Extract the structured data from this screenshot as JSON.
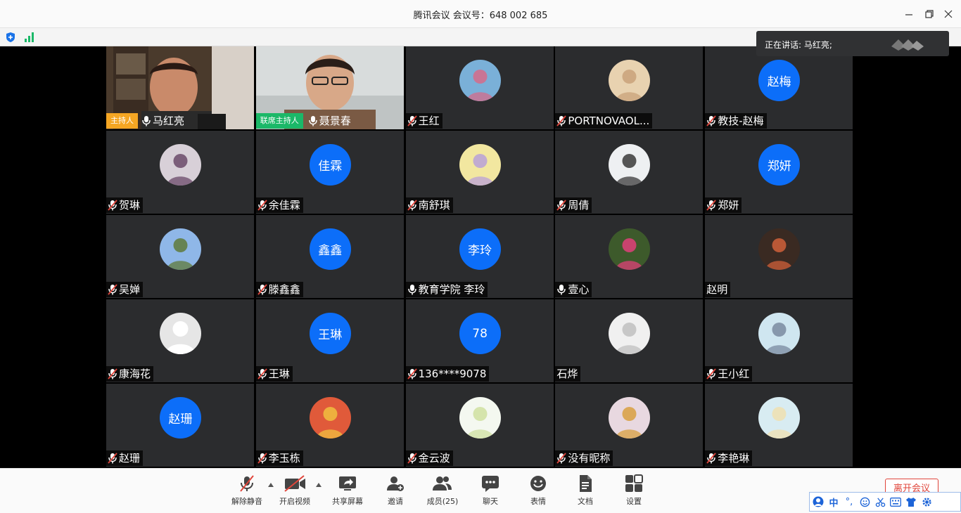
{
  "window": {
    "title": "腾讯会议 会议号：648 002 685"
  },
  "speaking": {
    "text": "正在讲话: 马红亮;"
  },
  "roles": {
    "host": "主持人",
    "cohost": "联席主持人"
  },
  "participants": [
    {
      "name": "马红亮",
      "mic": "on",
      "avatar": "video-host",
      "role": "host"
    },
    {
      "name": "聂景春",
      "mic": "on",
      "avatar": "video-cohost",
      "role": "cohost"
    },
    {
      "name": "王红",
      "mic": "muted",
      "avatar": "photo"
    },
    {
      "name": "PORTNOVAOL...",
      "mic": "muted",
      "avatar": "photo"
    },
    {
      "name": "教技-赵梅",
      "mic": "muted",
      "avatar": "text",
      "avatar_text": "赵梅"
    },
    {
      "name": "贺琳",
      "mic": "muted",
      "avatar": "photo"
    },
    {
      "name": "余佳霖",
      "mic": "muted",
      "avatar": "text",
      "avatar_text": "佳霖"
    },
    {
      "name": "南舒琪",
      "mic": "muted",
      "avatar": "photo"
    },
    {
      "name": "周倩",
      "mic": "muted",
      "avatar": "photo"
    },
    {
      "name": "郑妍",
      "mic": "muted",
      "avatar": "text",
      "avatar_text": "郑妍"
    },
    {
      "name": "吴婵",
      "mic": "muted",
      "avatar": "photo"
    },
    {
      "name": "滕鑫鑫",
      "mic": "muted",
      "avatar": "text",
      "avatar_text": "鑫鑫"
    },
    {
      "name": "教育学院 李玲",
      "mic": "on",
      "avatar": "text",
      "avatar_text": "李玲"
    },
    {
      "name": "壹心",
      "mic": "on",
      "avatar": "photo"
    },
    {
      "name": "赵明",
      "mic": "none",
      "avatar": "photo"
    },
    {
      "name": "康海花",
      "mic": "muted",
      "avatar": "default"
    },
    {
      "name": "王琳",
      "mic": "muted",
      "avatar": "text",
      "avatar_text": "王琳"
    },
    {
      "name": "136****9078",
      "mic": "muted",
      "avatar": "text",
      "avatar_text": "78"
    },
    {
      "name": "石烨",
      "mic": "none",
      "avatar": "photo"
    },
    {
      "name": "王小红",
      "mic": "muted",
      "avatar": "photo"
    },
    {
      "name": "赵珊",
      "mic": "muted",
      "avatar": "text",
      "avatar_text": "赵珊"
    },
    {
      "name": "李玉栋",
      "mic": "muted",
      "avatar": "photo"
    },
    {
      "name": "金云波",
      "mic": "muted",
      "avatar": "photo"
    },
    {
      "name": "没有昵称",
      "mic": "muted",
      "avatar": "photo"
    },
    {
      "name": "李艳琳",
      "mic": "muted",
      "avatar": "photo"
    }
  ],
  "toolbar": {
    "unmute": "解除静音",
    "start_video": "开启视频",
    "share_screen": "共享屏幕",
    "invite": "邀请",
    "members": "成员(25)",
    "chat": "聊天",
    "reactions": "表情",
    "docs": "文档",
    "settings": "设置",
    "leave": "离开会议"
  },
  "ime": {
    "mode": "中",
    "punct": "°,"
  },
  "colors": {
    "accent_blue": "#0c6ef9",
    "host_tag": "#f5a623",
    "cohost_tag": "#1bb868",
    "leave_red": "#e0443a",
    "tile_bg": "#2b2c2e"
  }
}
